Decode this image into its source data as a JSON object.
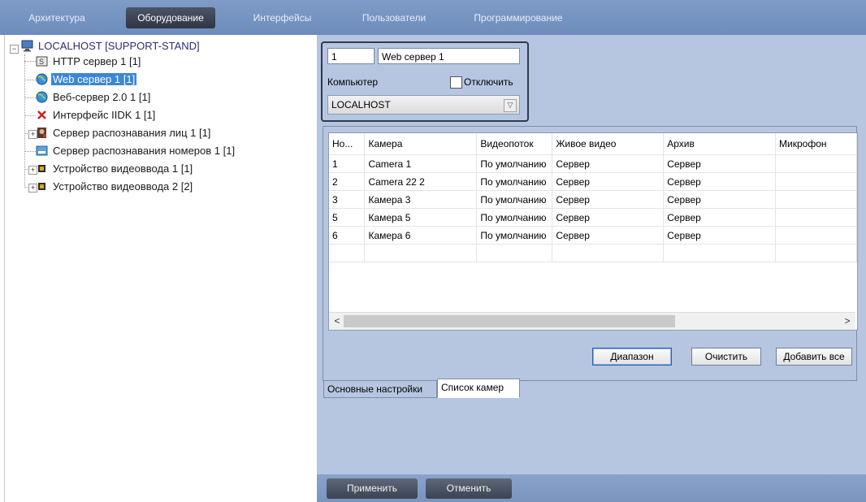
{
  "top_tabs": [
    "Архитектура",
    "Оборудование",
    "Интерфейсы",
    "Пользователи",
    "Программирование"
  ],
  "tree": {
    "root": "LOCALHOST [SUPPORT-STAND]",
    "items": [
      "HTTP сервер 1 [1]",
      "Web сервер 1 [1]",
      "Веб-сервер 2.0 1 [1]",
      "Интерфейс IIDK 1 [1]",
      "Сервер распознавания лиц 1 [1]",
      "Сервер распознавания номеров 1 [1]",
      "Устройство видеоввода 1 [1]",
      "Устройство видеоввода 2 [2]"
    ]
  },
  "settings": {
    "id_value": "1",
    "name_value": "Web сервер 1",
    "computer_label": "Компьютер",
    "disable_label": "Отключить",
    "computer_value": "LOCALHOST"
  },
  "table": {
    "columns": [
      "Но...",
      "Камера",
      "Видеопоток",
      "Живое видео",
      "Архив",
      "Микрофон"
    ],
    "rows": [
      [
        "1",
        "Camera 1",
        "По умолчанию",
        "Сервер",
        "Сервер",
        ""
      ],
      [
        "2",
        "Camera 22 2",
        "По умолчанию",
        "Сервер",
        "Сервер",
        ""
      ],
      [
        "3",
        "Камера 3",
        "По умолчанию",
        "Сервер",
        "Сервер",
        ""
      ],
      [
        "5",
        "Камера 5",
        "По умолчанию",
        "Сервер",
        "Сервер",
        ""
      ],
      [
        "6",
        "Камера 6",
        "По умолчанию",
        "Сервер",
        "Сервер",
        ""
      ]
    ]
  },
  "buttons": {
    "range": "Диапазон",
    "clear": "Очистить",
    "add_all": "Добавить все",
    "apply": "Применить",
    "cancel": "Отменить"
  },
  "sub_tabs": [
    "Основные настройки",
    "Список камер"
  ],
  "colors": {
    "topbar": "#7391c0",
    "panel": "#b6c6e0",
    "selection": "#3c86d6"
  }
}
